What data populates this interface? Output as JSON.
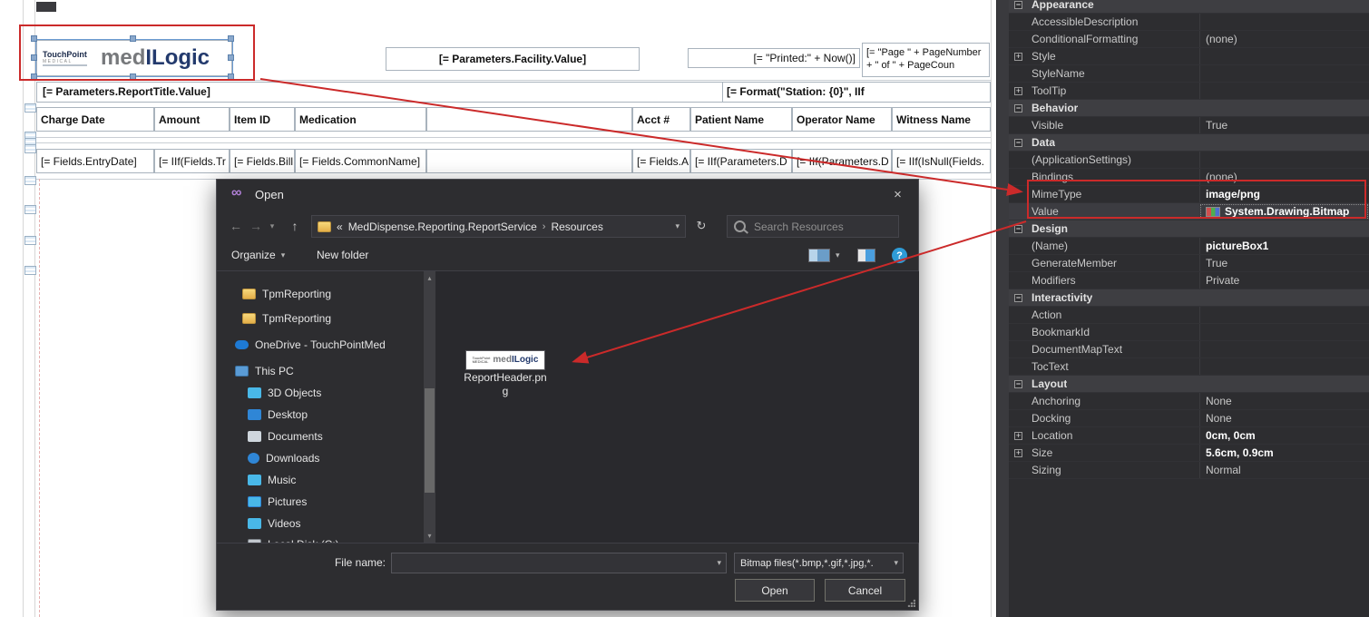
{
  "annotations": {
    "color": "#cb2a2a"
  },
  "icons": {
    "back": "←",
    "forward": "→",
    "up": "↑",
    "refresh": "↻",
    "chevron_down": "▾",
    "scroll_up": "▴",
    "scroll_down": "▾",
    "close": "×",
    "vs_logo": "∞",
    "collapse": "−",
    "expand": "+",
    "crumb_prefix_arrows": "«",
    "crumb_sep": "›"
  },
  "designer": {
    "logo": {
      "brand_small_top": "TouchPoint",
      "brand_small_bottom": "MEDICAL",
      "brand_main_gray": "med",
      "brand_main_blue": "ILogic"
    },
    "facility_cell": "[= Parameters.Facility.Value]",
    "printed_cell": "[= \"Printed:\" + Now()]",
    "page_cell": "[= \"Page \" + PageNumber + \" of \" + PageCoun",
    "report_title_cell": "[= Parameters.ReportTitle.Value]",
    "station_cell": "[= Format(\"Station: {0}\", IIf",
    "columns": [
      {
        "header": "Charge Date",
        "detail": "[= Fields.EntryDate]"
      },
      {
        "header": "Amount",
        "detail": "[= IIf(Fields.Tr"
      },
      {
        "header": "Item ID",
        "detail": "[= Fields.Bill"
      },
      {
        "header": "Medication",
        "detail": "[= Fields.CommonName]"
      },
      {
        "header": "Acct #",
        "detail": "[= Fields.A"
      },
      {
        "header": "Patient Name",
        "detail": "[= IIf(Parameters.D"
      },
      {
        "header": "Operator Name",
        "detail": "[= IIf(Parameters.D"
      },
      {
        "header": "Witness Name",
        "detail": "[= IIf(IsNull(Fields."
      }
    ]
  },
  "dialog": {
    "title": "Open",
    "breadcrumb": {
      "prefix": "«",
      "path": "MedDispense.Reporting.ReportService",
      "separator": "›",
      "current": "Resources"
    },
    "search": {
      "placeholder": "Search Resources"
    },
    "toolbar": {
      "organize": "Organize",
      "new_folder": "New folder",
      "help": "?"
    },
    "tree": [
      {
        "label": "TpmReporting",
        "icon": "folder",
        "indent": 28
      },
      {
        "label": "TpmReporting",
        "icon": "folder",
        "indent": 28
      },
      {
        "label": "OneDrive - TouchPointMed",
        "icon": "cloud",
        "indent": 20
      },
      {
        "label": "This PC",
        "icon": "computer",
        "indent": 20
      },
      {
        "label": "3D Objects",
        "icon": "objects3d",
        "indent": 34
      },
      {
        "label": "Desktop",
        "icon": "desktop",
        "indent": 34
      },
      {
        "label": "Documents",
        "icon": "documents",
        "indent": 34
      },
      {
        "label": "Downloads",
        "icon": "downloads",
        "indent": 34
      },
      {
        "label": "Music",
        "icon": "music",
        "indent": 34
      },
      {
        "label": "Pictures",
        "icon": "pictures",
        "indent": 34
      },
      {
        "label": "Videos",
        "icon": "videos",
        "indent": 34
      },
      {
        "label": "Local Disk (C:)",
        "icon": "disk",
        "indent": 34
      }
    ],
    "file": {
      "label_line1": "ReportHeader.pn",
      "label_line2": "g",
      "thumb_small_top": "TouchPoint",
      "thumb_small_bottom": "MEDICAL",
      "thumb_main_gray": "med",
      "thumb_main_blue": "ILogic"
    },
    "footer": {
      "file_name_label": "File name:",
      "file_name_value": "",
      "file_type": "Bitmap files(*.bmp,*.gif,*.jpg,*.",
      "open": "Open",
      "cancel": "Cancel"
    }
  },
  "properties": {
    "rows": [
      {
        "kind": "category",
        "name": "Appearance"
      },
      {
        "kind": "prop",
        "name": "AccessibleDescription",
        "value": ""
      },
      {
        "kind": "prop",
        "name": "ConditionalFormatting",
        "value": "(none)"
      },
      {
        "kind": "prop",
        "name": "Style",
        "value": "",
        "expand": true
      },
      {
        "kind": "prop",
        "name": "StyleName",
        "value": ""
      },
      {
        "kind": "prop",
        "name": "ToolTip",
        "value": "",
        "expand": true
      },
      {
        "kind": "category",
        "name": "Behavior"
      },
      {
        "kind": "prop",
        "name": "Visible",
        "value": "True"
      },
      {
        "kind": "category",
        "name": "Data"
      },
      {
        "kind": "prop",
        "name": "(ApplicationSettings)",
        "value": ""
      },
      {
        "kind": "prop",
        "name": "Bindings",
        "value": "(none)"
      },
      {
        "kind": "prop",
        "name": "MimeType",
        "value": "image/png",
        "bold": true
      },
      {
        "kind": "prop",
        "name": "Value",
        "value": "System.Drawing.Bitmap",
        "bold": true,
        "selected": true,
        "icon": "bitmap"
      },
      {
        "kind": "category",
        "name": "Design"
      },
      {
        "kind": "prop",
        "name": "(Name)",
        "value": "pictureBox1",
        "bold": true
      },
      {
        "kind": "prop",
        "name": "GenerateMember",
        "value": "True"
      },
      {
        "kind": "prop",
        "name": "Modifiers",
        "value": "Private"
      },
      {
        "kind": "category",
        "name": "Interactivity"
      },
      {
        "kind": "prop",
        "name": "Action",
        "value": ""
      },
      {
        "kind": "prop",
        "name": "BookmarkId",
        "value": ""
      },
      {
        "kind": "prop",
        "name": "DocumentMapText",
        "value": ""
      },
      {
        "kind": "prop",
        "name": "TocText",
        "value": ""
      },
      {
        "kind": "category",
        "name": "Layout"
      },
      {
        "kind": "prop",
        "name": "Anchoring",
        "value": "None"
      },
      {
        "kind": "prop",
        "name": "Docking",
        "value": "None"
      },
      {
        "kind": "prop",
        "name": "Location",
        "value": "0cm, 0cm",
        "expand": true,
        "bold": true
      },
      {
        "kind": "prop",
        "name": "Size",
        "value": "5.6cm, 0.9cm",
        "expand": true,
        "bold": true
      },
      {
        "kind": "prop",
        "name": "Sizing",
        "value": "Normal"
      }
    ]
  }
}
